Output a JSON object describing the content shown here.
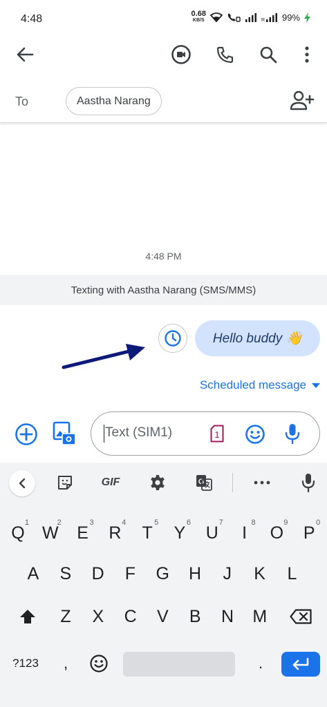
{
  "status_bar": {
    "time": "4:48",
    "net_speed": "0.68",
    "net_unit": "KB/S",
    "battery_pct": "99%"
  },
  "toolbar": {
    "icons": [
      "back-arrow-icon",
      "video-call-icon",
      "phone-icon",
      "search-icon",
      "more-vert-icon"
    ]
  },
  "recipient": {
    "to_label": "To",
    "chip_name": "Aastha Narang"
  },
  "conversation": {
    "timestamp": "4:48 PM",
    "banner": "Texting with Aastha Narang (SMS/MMS)",
    "message_text": "Hello buddy 👋",
    "scheduled_label": "Scheduled message"
  },
  "compose": {
    "placeholder": "Text (SIM1)",
    "sim_number": "1"
  },
  "keyboard": {
    "row1": [
      {
        "k": "Q",
        "h": "1"
      },
      {
        "k": "W",
        "h": "2"
      },
      {
        "k": "E",
        "h": "3"
      },
      {
        "k": "R",
        "h": "4"
      },
      {
        "k": "T",
        "h": "5"
      },
      {
        "k": "Y",
        "h": "6"
      },
      {
        "k": "U",
        "h": "7"
      },
      {
        "k": "I",
        "h": "8"
      },
      {
        "k": "O",
        "h": "9"
      },
      {
        "k": "P",
        "h": "0"
      }
    ],
    "row2": [
      "A",
      "S",
      "D",
      "F",
      "G",
      "H",
      "J",
      "K",
      "L"
    ],
    "row3": [
      "Z",
      "X",
      "C",
      "V",
      "B",
      "N",
      "M"
    ],
    "symbols_label": "?123",
    "comma": ",",
    "period": ".",
    "gif_label": "GIF"
  },
  "colors": {
    "accent": "#1a73e8",
    "bubble": "#d3e3fd",
    "arrow": "#0d1a7a",
    "sim_icon": "#a0185a"
  }
}
